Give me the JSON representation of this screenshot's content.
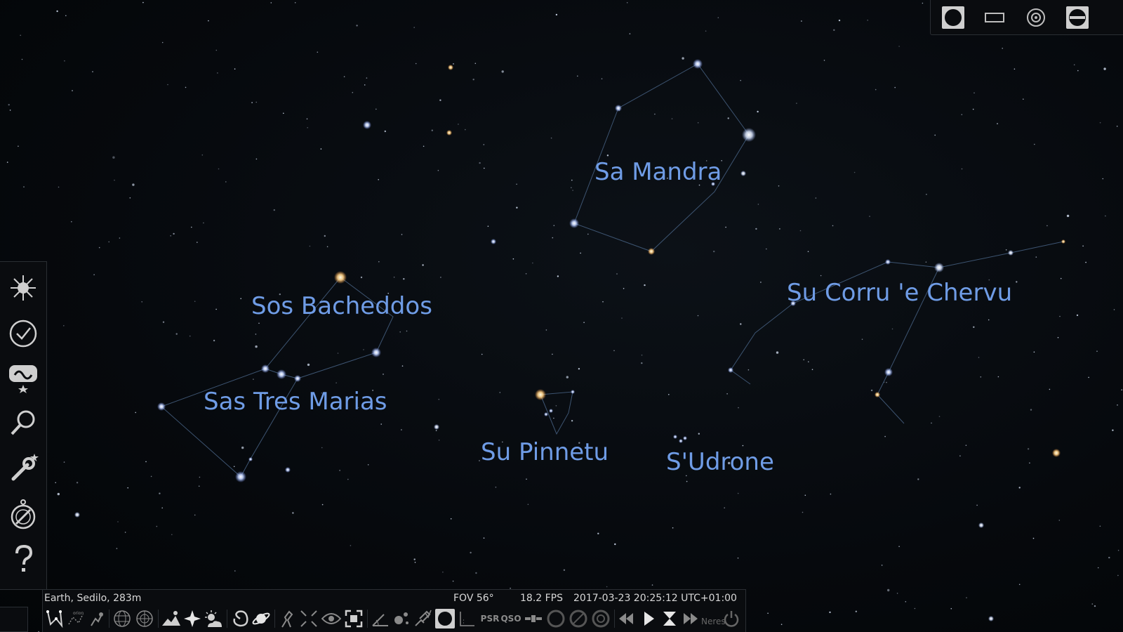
{
  "sky": {
    "constellations": [
      {
        "name": "Sa Mandra"
      },
      {
        "name": "Sos Bacheddos"
      },
      {
        "name": "Sas Tres Marias"
      },
      {
        "name": "Su Corru 'e Chervu"
      },
      {
        "name": "Su Pinnetu"
      },
      {
        "name": "S'Udrone"
      }
    ]
  },
  "status_bar": {
    "location": "Earth, Sedilo, 283m",
    "fov": "FOV 56°",
    "fps": "18.2 FPS",
    "datetime": "2017-03-23 20:25:12 UTC+01:00"
  },
  "bottom_toolbar": {
    "pulsars_label": "PSR",
    "quasars_label": "QSO",
    "hint_text": "Neres"
  },
  "colors": {
    "label": "#6f9ce6",
    "line": "#3d5471",
    "icon": "#cfcfcf",
    "panel": "#0a0c0f"
  }
}
